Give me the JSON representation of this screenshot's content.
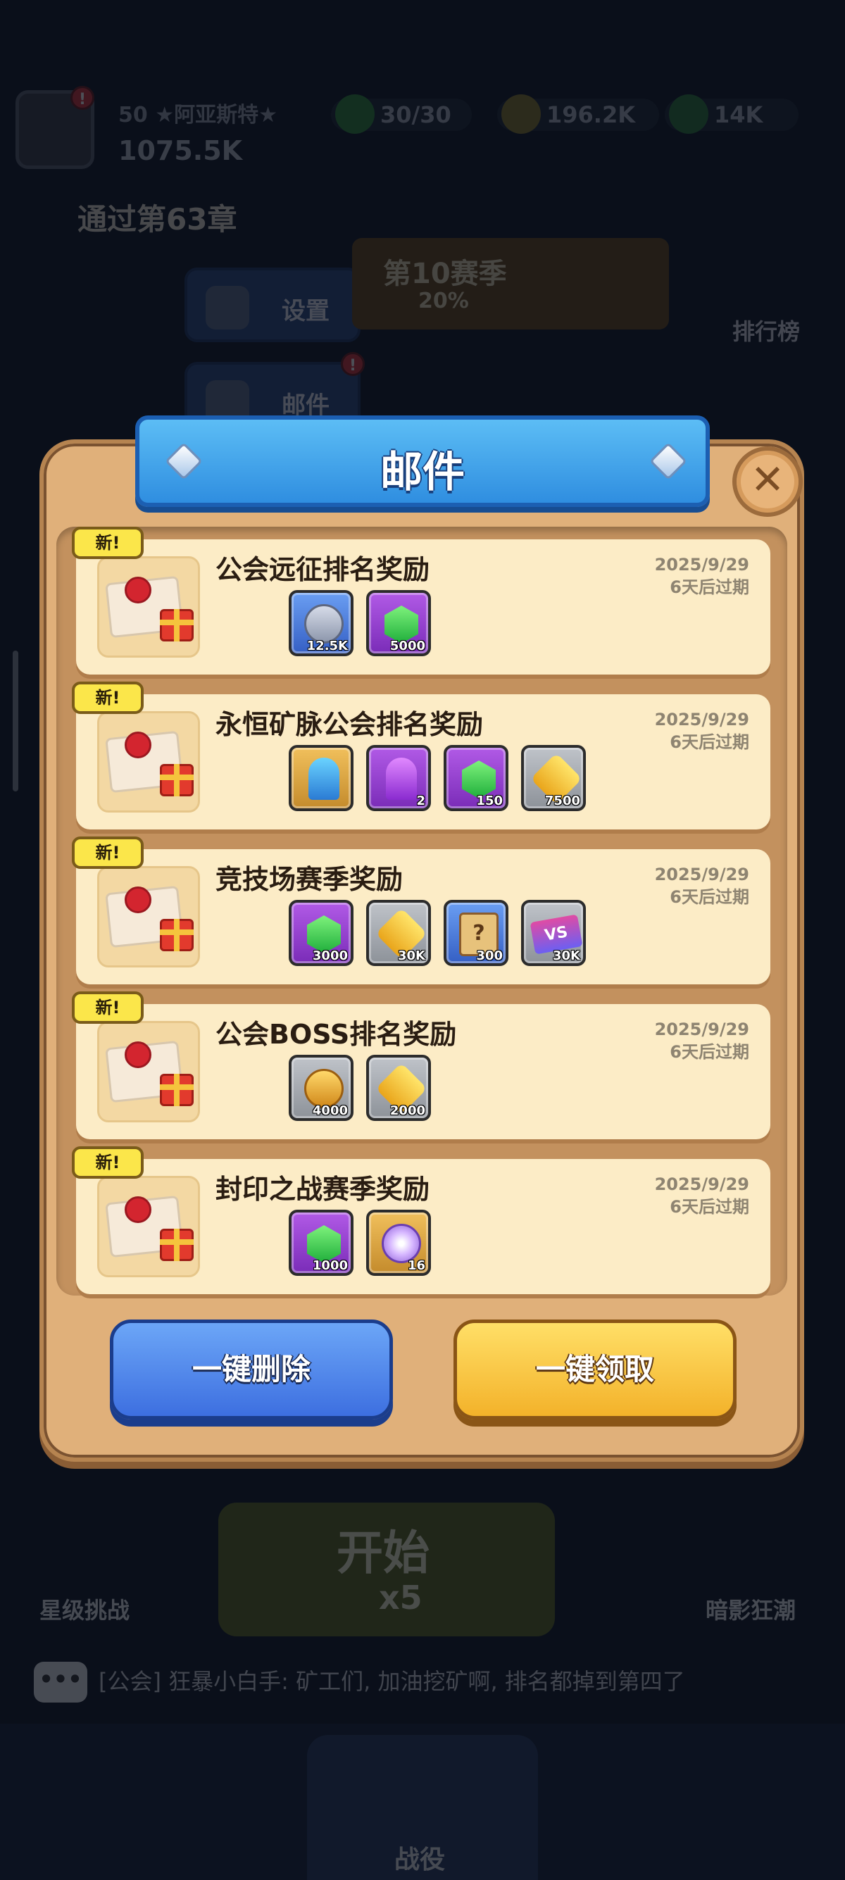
{
  "background": {
    "player": {
      "level_name": "50 ★阿亚斯特★",
      "power": "1075.5K"
    },
    "resources": [
      {
        "icon": "energy-icon",
        "value": "30/30"
      },
      {
        "icon": "gold-bag-icon",
        "value": "196.2K"
      },
      {
        "icon": "gem-icon",
        "value": "14K"
      }
    ],
    "chapter_text": "通过第63章",
    "menu": {
      "settings_label": "设置",
      "mail_label": "邮件"
    },
    "season": {
      "title": "第10赛季",
      "progress": "20%"
    },
    "leaderboard_label": "排行榜",
    "start": {
      "label": "开始",
      "cost": "x5"
    },
    "modes": {
      "left": "星级挑战",
      "right": "暗影狂潮"
    },
    "chat": {
      "icon_text": "•••",
      "text": "[公会] 狂暴小白手: 矿工们, 加油挖矿啊, 排名都掉到第四了"
    },
    "nav": {
      "active_label": "战役"
    },
    "badge": "!"
  },
  "dialog": {
    "title": "邮件",
    "close_symbol": "✕",
    "new_tag": "新!",
    "mails": [
      {
        "title": "公会远征排名奖励",
        "date": "2025/9/29",
        "expire": "6天后过期",
        "rewards": [
          {
            "icon": "silver-medal-icon",
            "style": "blue",
            "shape": "medal",
            "count": "12.5K"
          },
          {
            "icon": "green-gem-icon",
            "style": "purple",
            "shape": "gem",
            "count": "5000"
          }
        ]
      },
      {
        "title": "永恒矿脉公会排名奖励",
        "date": "2025/9/29",
        "expire": "6天后过期",
        "rewards": [
          {
            "icon": "blue-key-icon",
            "style": "gold",
            "shape": "key",
            "count": ""
          },
          {
            "icon": "purple-key-icon",
            "style": "purple",
            "shape": "key-p",
            "count": "2"
          },
          {
            "icon": "green-gem-icon",
            "style": "purple",
            "shape": "gem",
            "count": "150"
          },
          {
            "icon": "gold-coin-icon",
            "style": "gray",
            "shape": "coin",
            "count": "7500"
          }
        ]
      },
      {
        "title": "竞技场赛季奖励",
        "date": "2025/9/29",
        "expire": "6天后过期",
        "rewards": [
          {
            "icon": "green-gem-icon",
            "style": "purple",
            "shape": "gem",
            "count": "3000"
          },
          {
            "icon": "gold-coin-icon",
            "style": "gray",
            "shape": "coin",
            "count": "30K"
          },
          {
            "icon": "mystery-scroll-icon",
            "style": "blue",
            "shape": "scroll",
            "mark": "?",
            "count": "300"
          },
          {
            "icon": "vs-ticket-icon",
            "style": "gray",
            "shape": "ticket",
            "mark": "VS",
            "count": "30K"
          }
        ]
      },
      {
        "title": "公会BOSS排名奖励",
        "date": "2025/9/29",
        "expire": "6天后过期",
        "rewards": [
          {
            "icon": "guild-token-icon",
            "style": "gray",
            "shape": "token",
            "count": "4000"
          },
          {
            "icon": "gold-coin-icon",
            "style": "gray",
            "shape": "coin",
            "count": "2000"
          }
        ]
      },
      {
        "title": "封印之战赛季奖励",
        "date": "2025/9/29",
        "expire": "6天后过期",
        "rewards": [
          {
            "icon": "green-gem-icon",
            "style": "purple",
            "shape": "gem",
            "count": "1000"
          },
          {
            "icon": "star-orb-icon",
            "style": "gold",
            "shape": "orb",
            "count": "16"
          }
        ]
      }
    ],
    "buttons": {
      "delete_all": "一键删除",
      "claim_all": "一键领取"
    }
  }
}
